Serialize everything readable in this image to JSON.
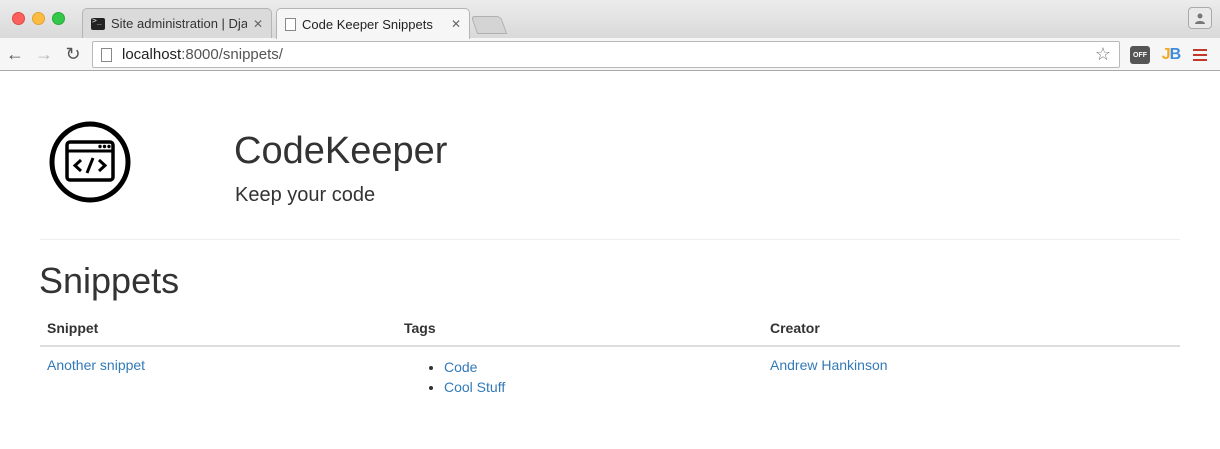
{
  "browser": {
    "tabs": [
      {
        "title": "Site administration | Django",
        "active": false
      },
      {
        "title": "Code Keeper Snippets",
        "active": true
      }
    ],
    "url": {
      "host": "localhost",
      "path": ":8000/snippets/"
    },
    "extensions": {
      "off_label": "OFF",
      "jb_label": "JB"
    }
  },
  "site": {
    "title": "CodeKeeper",
    "tagline": "Keep your code",
    "logo_icon": "code-window-icon"
  },
  "snippets": {
    "heading": "Snippets",
    "columns": [
      "Snippet",
      "Tags",
      "Creator"
    ],
    "rows": [
      {
        "snippet": "Another snippet",
        "tags": [
          "Code",
          "Cool Stuff"
        ],
        "creator": "Andrew Hankinson"
      }
    ]
  },
  "colors": {
    "link": "#337ab7",
    "text": "#333333"
  }
}
